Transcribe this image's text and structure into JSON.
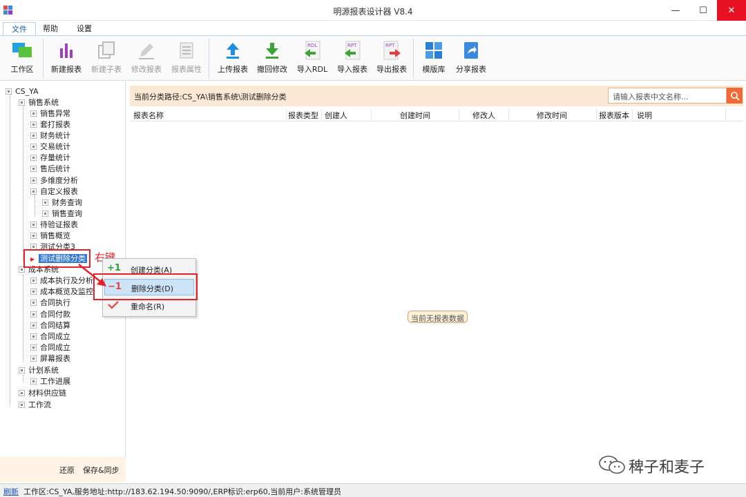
{
  "window": {
    "title": "明源报表设计器 V8.4",
    "minimize": "—",
    "maximize": "☐",
    "close": "✕"
  },
  "menu": {
    "items": [
      "文件",
      "帮助",
      "设置"
    ]
  },
  "toolbar": {
    "workspace": "工作区",
    "new_report": "新建报表",
    "new_child": "新建子表",
    "edit_report": "修改报表",
    "report_props": "报表属性",
    "upload_report": "上传报表",
    "revert_changes": "撤回修改",
    "import_rdl": "导入RDL",
    "import_report": "导入报表",
    "export_report": "导出报表",
    "template_lib": "模版库",
    "share_report": "分享报表"
  },
  "tree": {
    "root": "CS_YA",
    "items": [
      "销售系统",
      "销售异常",
      "套打报表",
      "财务统计",
      "交易统计",
      "存量统计",
      "售后统计",
      "多维度分析",
      "自定义报表",
      "财务查询",
      "销售查询",
      "待验证报表",
      "销售概览",
      "测试分类3",
      "测试删除分类",
      "成本系统",
      "成本执行及分析",
      "成本概览及监控",
      "合同执行",
      "合同付款",
      "合同结算",
      "合同成立",
      "合同成立",
      "屏幕报表",
      "计划系统",
      "工作进展",
      "材料供应链",
      "工作流"
    ]
  },
  "left_footer": {
    "restore": "还原",
    "save_sync": "保存&同步"
  },
  "path_bar": {
    "text": "当前分类路径:CS_YA\\销售系统\\测试删除分类",
    "search_placeholder": "请输入报表中文名称..."
  },
  "grid": {
    "columns": [
      "报表名称",
      "报表类型",
      "创建人",
      "创建时间",
      "修改人",
      "修改时间",
      "报表版本",
      "说明"
    ],
    "empty_text": "当前无报表数据"
  },
  "context_menu": {
    "create": "创建分类(A)",
    "delete": "删除分类(D)",
    "rename": "重命名(R)"
  },
  "annotation": {
    "right_click": "右键"
  },
  "status": {
    "refresh": "刷新",
    "info": "工作区:CS_YA,服务地址:http://183.62.194.50:9090/,ERP标识:erp60,当前用户:系统管理员"
  },
  "watermark": {
    "text": "稗子和麦子"
  },
  "colors": {
    "accent": "#3478d4",
    "highlight_red": "#e8202a",
    "path_bg": "#fbe9d5",
    "search_button": "#f06a37"
  }
}
